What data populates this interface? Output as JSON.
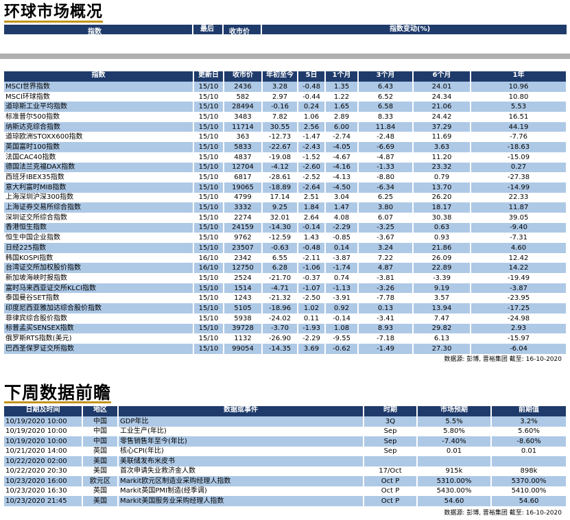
{
  "section1": {
    "title": "环球市场概况",
    "header_top": {
      "index": "指数",
      "last": "最后",
      "close": "收市价",
      "change": "指数变动(%)"
    },
    "columns": [
      "指数",
      "更新日",
      "收市价",
      "年初至今",
      "5日",
      "1个月",
      "3个月",
      "6个月",
      "1年"
    ],
    "rows": [
      [
        "MSCI世界指数",
        "15/10",
        "2436",
        "3.28",
        "-0.48",
        "1.35",
        "6.43",
        "24.01",
        "10.96"
      ],
      [
        "MSCI环球指数",
        "15/10",
        "582",
        "2.97",
        "-0.44",
        "1.22",
        "6.52",
        "24.34",
        "10.80"
      ],
      [
        "道琼斯工业平均指数",
        "15/10",
        "28494",
        "-0.16",
        "0.24",
        "1.65",
        "6.58",
        "21.06",
        "5.53"
      ],
      [
        "标准普尔500指数",
        "15/10",
        "3483",
        "7.82",
        "1.06",
        "2.89",
        "8.33",
        "24.42",
        "16.51"
      ],
      [
        "纳斯达克综合指数",
        "15/10",
        "11714",
        "30.55",
        "2.56",
        "6.00",
        "11.84",
        "37.29",
        "44.19"
      ],
      [
        "道琼欧洲STOXX600指数",
        "15/10",
        "363",
        "-12.73",
        "-1.47",
        "-2.74",
        "-2.48",
        "11.69",
        "-7.76"
      ],
      [
        "英国富时100指数",
        "15/10",
        "5833",
        "-22.67",
        "-2.43",
        "-4.05",
        "-6.69",
        "3.63",
        "-18.63"
      ],
      [
        "法国CAC40指数",
        "15/10",
        "4837",
        "-19.08",
        "-1.52",
        "-4.67",
        "-4.87",
        "11.20",
        "-15.09"
      ],
      [
        "德国法兰克福DAX指数",
        "15/10",
        "12704",
        "-4.12",
        "-2.60",
        "-4.16",
        "-1.33",
        "23.32",
        "0.27"
      ],
      [
        "西班牙IBEX35指数",
        "15/10",
        "6817",
        "-28.61",
        "-2.52",
        "-4.13",
        "-8.80",
        "0.79",
        "-27.38"
      ],
      [
        "意大利富时MIB指数",
        "15/10",
        "19065",
        "-18.89",
        "-2.64",
        "-4.50",
        "-6.34",
        "13.70",
        "-14.99"
      ],
      [
        "上海深圳沪深300指数",
        "15/10",
        "4799",
        "17.14",
        "2.51",
        "3.04",
        "6.25",
        "26.20",
        "22.33"
      ],
      [
        "上海证券交易所综合指数",
        "15/10",
        "3332",
        "9.25",
        "1.84",
        "1.47",
        "3.80",
        "18.17",
        "11.87"
      ],
      [
        "深圳证交所综合指数",
        "15/10",
        "2274",
        "32.01",
        "2.64",
        "4.08",
        "6.07",
        "30.38",
        "39.05"
      ],
      [
        "香港恒生指数",
        "15/10",
        "24159",
        "-14.30",
        "-0.14",
        "-2.29",
        "-3.25",
        "0.63",
        "-9.40"
      ],
      [
        "恒生中国企业指数",
        "15/10",
        "9762",
        "-12.59",
        "1.43",
        "-0.85",
        "-3.67",
        "0.93",
        "-7.31"
      ],
      [
        "日经225指数",
        "15/10",
        "23507",
        "-0.63",
        "-0.48",
        "0.14",
        "3.24",
        "21.86",
        "4.60"
      ],
      [
        "韩国KOSPI指数",
        "16/10",
        "2342",
        "6.55",
        "-2.11",
        "-3.87",
        "7.22",
        "26.09",
        "12.42"
      ],
      [
        "台湾证交所加权股价指数",
        "16/10",
        "12750",
        "6.28",
        "-1.06",
        "-1.74",
        "4.87",
        "22.89",
        "14.22"
      ],
      [
        "新加坡海峡时报指数",
        "15/10",
        "2524",
        "-21.70",
        "-0.37",
        "0.74",
        "-3.81",
        "-3.39",
        "-19.49"
      ],
      [
        "富时马来西亚证交所KLCI指数",
        "15/10",
        "1514",
        "-4.71",
        "-1.07",
        "-1.13",
        "-3.26",
        "9.19",
        "-3.87"
      ],
      [
        "泰国曼谷SET指数",
        "15/10",
        "1243",
        "-21.32",
        "-2.50",
        "-3.91",
        "-7.78",
        "3.57",
        "-23.95"
      ],
      [
        "印度尼西亚雅加达综合股价指数",
        "15/10",
        "5105",
        "-18.96",
        "1.02",
        "0.92",
        "0.13",
        "13.94",
        "-17.25"
      ],
      [
        "菲律宾综合股价指数",
        "15/10",
        "5938",
        "-24.02",
        "0.11",
        "-0.14",
        "-3.41",
        "7.47",
        "-24.98"
      ],
      [
        "标普孟买SENSEX指数",
        "15/10",
        "39728",
        "-3.70",
        "-1.93",
        "1.08",
        "8.93",
        "29.82",
        "2.93"
      ],
      [
        "俄罗斯RTS指数(美元)",
        "15/10",
        "1132",
        "-26.90",
        "-2.29",
        "-9.55",
        "-7.18",
        "6.13",
        "-15.97"
      ],
      [
        "巴西圣保罗证交所指数",
        "15/10",
        "99054",
        "-14.35",
        "3.69",
        "-0.62",
        "-1.49",
        "27.30",
        "-6.04"
      ]
    ],
    "source": "数据源: 彭博, 晋裕集团 截至: 16-10-2020"
  },
  "section2": {
    "title": "下周数据前瞻",
    "columns": [
      "日期及时间",
      "地区",
      "数据或事件",
      "时期",
      "市场预期",
      "前期值"
    ],
    "rows": [
      [
        "10/19/2020 10:00",
        "中国",
        "GDP年比",
        "3Q",
        "5.5%",
        "3.2%"
      ],
      [
        "10/19/2020 10:00",
        "中国",
        "工业生产(年比)",
        "Sep",
        "5.80%",
        "5.60%"
      ],
      [
        "10/19/2020 10:00",
        "中国",
        "零售销售年至今(年比)",
        "Sep",
        "-7.40%",
        "-8.60%"
      ],
      [
        "10/21/2020 14:00",
        "英国",
        "核心CPI(年比)",
        "Sep",
        "0.01",
        "0.01"
      ],
      [
        "10/22/2020 02:00",
        "美国",
        "美联储发布米皮书",
        "",
        "",
        ""
      ],
      [
        "10/22/2020 20:30",
        "美国",
        "首次申请失业救济金人数",
        "17/Oct",
        "915k",
        "898k"
      ],
      [
        "10/23/2020 16:00",
        "欧元区",
        "Markit欧元区制造业采购经理人指数",
        "Oct P",
        "5310.00%",
        "5370.00%"
      ],
      [
        "10/23/2020 16:30",
        "英国",
        "Markit英国PMI制造(经季调)",
        "Oct P",
        "5430.00%",
        "5410.00%"
      ],
      [
        "10/23/2020 21:45",
        "美国",
        "Markit美国服务业采购经理人指数",
        "Oct P",
        "54.60",
        "54.60"
      ]
    ],
    "source": "数据源: 彭博, 晋裕集团 截至: 16-10-2020"
  }
}
